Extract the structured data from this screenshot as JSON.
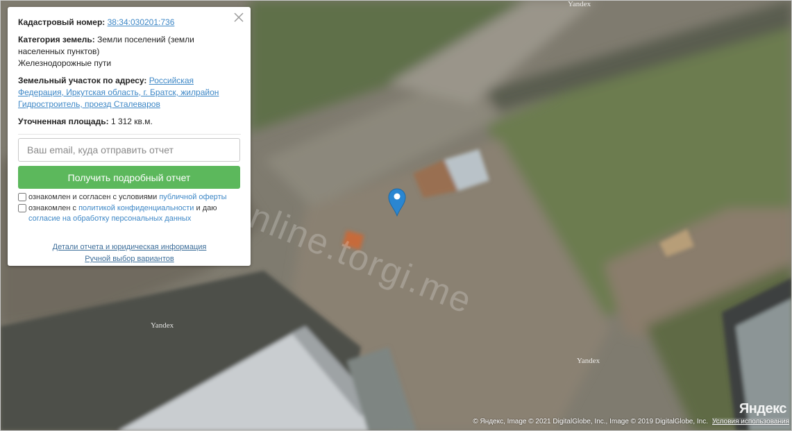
{
  "panel": {
    "cadastral": {
      "label": "Кадастровый номер:",
      "value": "38:34:030201:736"
    },
    "category": {
      "label": "Категория земель:",
      "value": "Земли поселений (земли населенных пунктов)",
      "subtype": "Железнодорожные пути"
    },
    "address": {
      "label": "Земельный участок по адресу:",
      "value": "Российская Федерация, Иркутская область, г. Братск, жилрайон Гидростроитель, проезд Сталеваров"
    },
    "area": {
      "label": "Уточненная площадь:",
      "value": "1 312 кв.м."
    },
    "email_placeholder": "Ваш email, куда отправить отчет",
    "report_button": "Получить подробный отчет",
    "consent_offer": {
      "text": "ознакомлен и согласен с условиями",
      "link": "публичной оферты"
    },
    "consent_privacy": {
      "text": "ознакомлен с",
      "link": "политикой конфиденциальности",
      "middle": "и даю",
      "link2": "согласие на обработку персональных данных"
    },
    "details_link": "Детали отчета и юридическая информация",
    "manual_link": "Ручной выбор вариантов"
  },
  "map": {
    "tile_labels": [
      "Yandex",
      "Yandex",
      "Yandex"
    ],
    "watermark": "online.torgi.me",
    "logo": "Яндекс",
    "copyright": "© Яндекс, Image © 2021 DigitalGlobe, Inc., Image © 2019 DigitalGlobe, Inc.",
    "terms": "Условия использования",
    "pin_color": "#2a86d1",
    "pin_icon": "map-marker-icon"
  }
}
